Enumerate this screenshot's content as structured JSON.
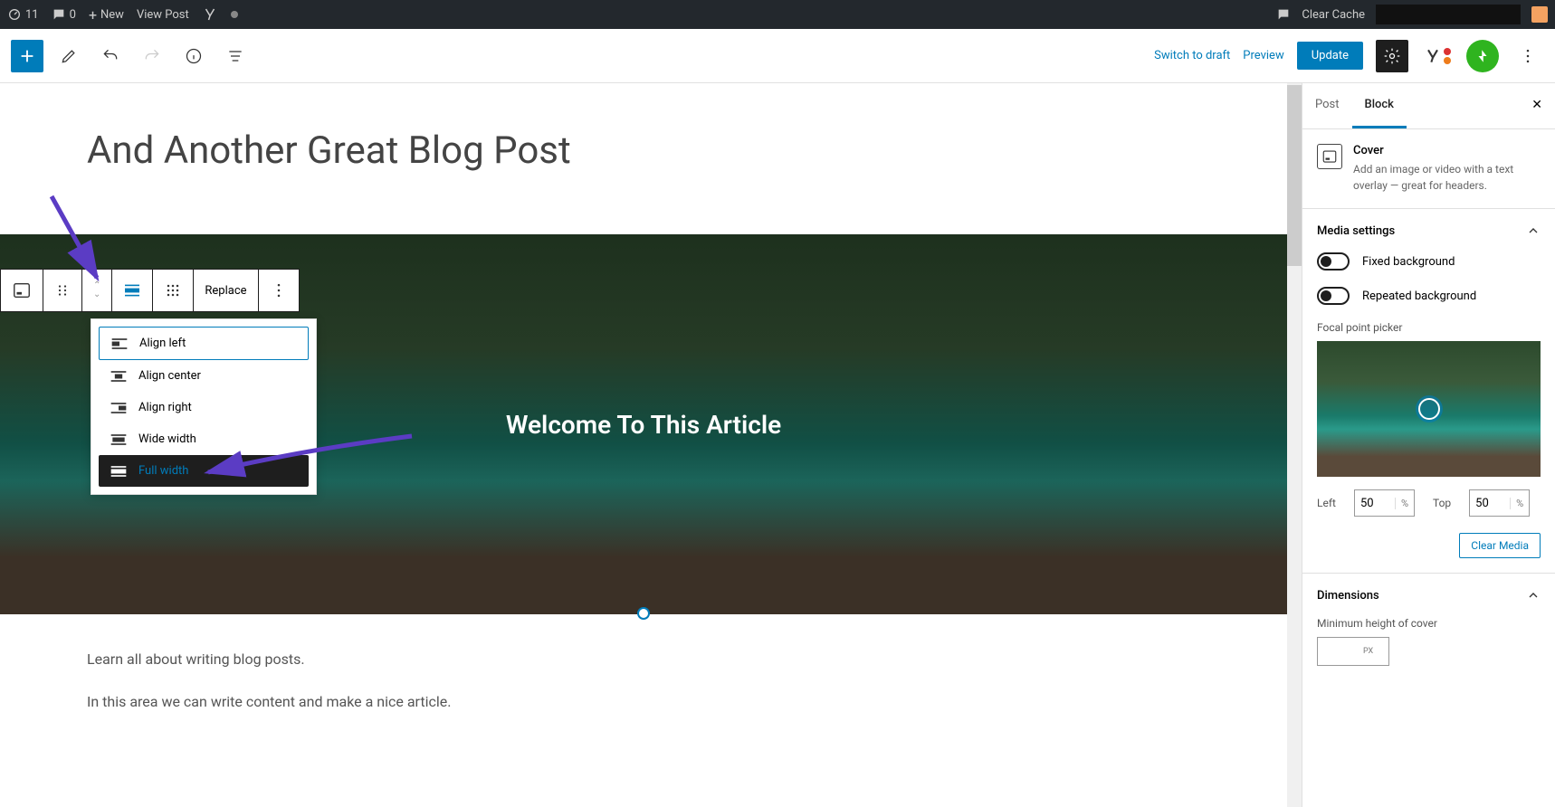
{
  "adminBar": {
    "comments": "11",
    "bubble": "0",
    "new": "New",
    "viewPost": "View Post",
    "clearCache": "Clear Cache"
  },
  "editorHeader": {
    "switchDraft": "Switch to draft",
    "preview": "Preview",
    "update": "Update"
  },
  "post": {
    "title": "And Another Great Blog Post",
    "coverText": "Welcome To This Article",
    "p1": "Learn all about writing blog posts.",
    "p2": "In this area we can write content and make a nice article."
  },
  "toolbar": {
    "replace": "Replace"
  },
  "alignMenu": {
    "left": "Align left",
    "center": "Align center",
    "right": "Align right",
    "wide": "Wide width",
    "full": "Full width"
  },
  "sidebar": {
    "tabPost": "Post",
    "tabBlock": "Block",
    "blockName": "Cover",
    "blockDesc": "Add an image or video with a text overlay — great for headers.",
    "mediaSettings": "Media settings",
    "fixedBg": "Fixed background",
    "repeatedBg": "Repeated background",
    "focalLabel": "Focal point picker",
    "leftLabel": "Left",
    "topLabel": "Top",
    "leftVal": "50",
    "topVal": "50",
    "percent": "%",
    "clearMedia": "Clear Media",
    "dimensions": "Dimensions",
    "minHeight": "Minimum height of cover",
    "px": "PX"
  }
}
